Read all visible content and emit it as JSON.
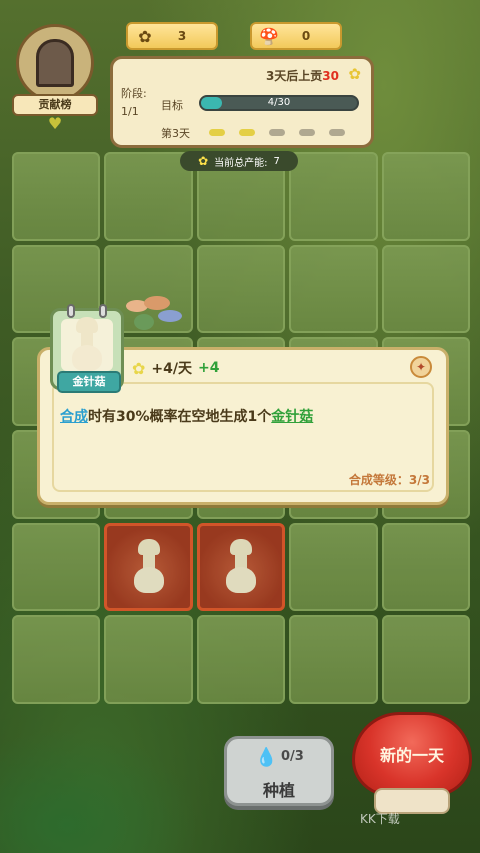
{
  "currency": [
    {
      "icon": "sunflower-icon",
      "value": "3"
    },
    {
      "icon": "mushroom-icon",
      "value": "0"
    }
  ],
  "house": {
    "ribbon": "贡献榜"
  },
  "stage": {
    "label": "阶段:",
    "value": "1/1",
    "reward_prefix": "3天后上贡",
    "reward_amount": "30",
    "target_label": "目标",
    "progress_text": "4/30",
    "progress_fraction": 0.133,
    "day_label": "第3天",
    "days_total": 5,
    "days_done": 2
  },
  "energy": {
    "label": "当前总产能:",
    "value": "7"
  },
  "grid": {
    "rows": 6,
    "cols": 5,
    "red_cells": [
      {
        "row": 4,
        "col": 1
      },
      {
        "row": 4,
        "col": 2
      }
    ]
  },
  "item": {
    "name": "金针菇",
    "production": "+4/天",
    "bonus": "+4",
    "desc_link1": "合成",
    "desc_middle": "时有30%概率在空地生成1个",
    "desc_link2": "金针菇",
    "level": "合成等级：3/3"
  },
  "plant_button": {
    "count": "0/3",
    "label": "种植"
  },
  "newday_button": {
    "label": "新的一天"
  },
  "watermark": "KK下载"
}
